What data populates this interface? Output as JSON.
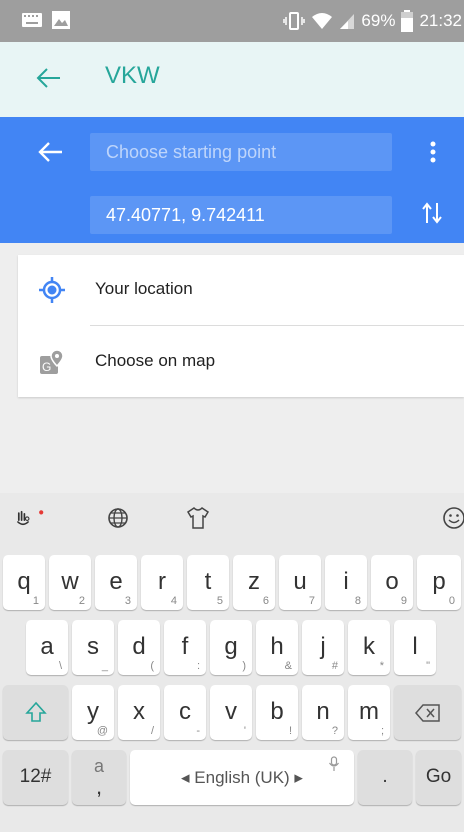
{
  "status_bar": {
    "battery": "69%",
    "time": "21:32"
  },
  "app_bar": {
    "title": "VKW"
  },
  "directions": {
    "start_placeholder": "Choose starting point",
    "destination_value": "47.40771, 9.742411"
  },
  "suggestions": [
    {
      "label": "Your location",
      "icon": "my-location-icon"
    },
    {
      "label": "Choose on map",
      "icon": "map-pin-icon"
    }
  ],
  "keyboard": {
    "row1": [
      {
        "k": "q",
        "s": "1"
      },
      {
        "k": "w",
        "s": "2"
      },
      {
        "k": "e",
        "s": "3"
      },
      {
        "k": "r",
        "s": "4"
      },
      {
        "k": "t",
        "s": "5"
      },
      {
        "k": "z",
        "s": "6"
      },
      {
        "k": "u",
        "s": "7"
      },
      {
        "k": "i",
        "s": "8"
      },
      {
        "k": "o",
        "s": "9"
      },
      {
        "k": "p",
        "s": "0"
      }
    ],
    "row2": [
      {
        "k": "a",
        "s": "\\"
      },
      {
        "k": "s",
        "s": "_"
      },
      {
        "k": "d",
        "s": "("
      },
      {
        "k": "f",
        "s": ":"
      },
      {
        "k": "g",
        "s": ")"
      },
      {
        "k": "h",
        "s": "&"
      },
      {
        "k": "j",
        "s": "#"
      },
      {
        "k": "k",
        "s": "*"
      },
      {
        "k": "l",
        "s": "\""
      }
    ],
    "row3": [
      {
        "k": "y",
        "s": "@"
      },
      {
        "k": "x",
        "s": "/"
      },
      {
        "k": "c",
        "s": "-"
      },
      {
        "k": "v",
        "s": "'"
      },
      {
        "k": "b",
        "s": "!"
      },
      {
        "k": "n",
        "s": "?"
      },
      {
        "k": "m",
        "s": ";"
      }
    ],
    "symbols_label": "12#",
    "comma_key": "a",
    "comma_sub": ",",
    "space_label": "◂ English (UK) ▸",
    "period_label": ".",
    "go_label": "Go"
  }
}
